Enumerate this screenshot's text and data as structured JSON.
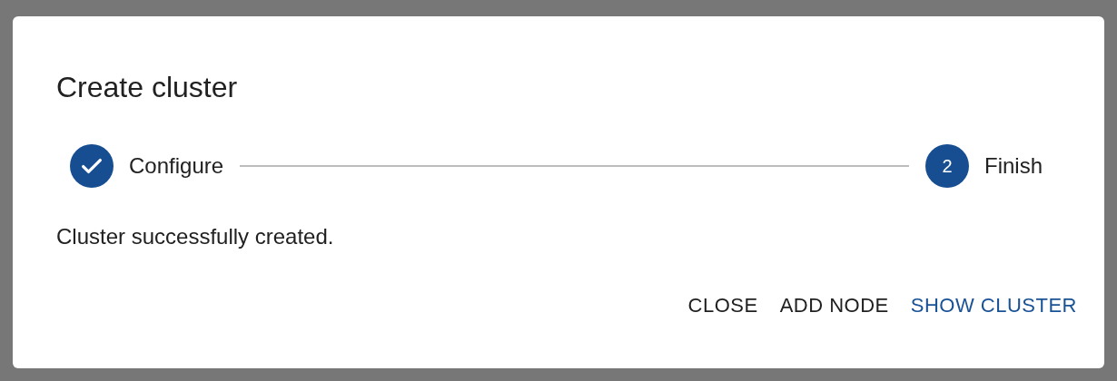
{
  "dialog": {
    "title": "Create cluster",
    "steps": [
      {
        "label": "Configure",
        "completed": true
      },
      {
        "label": "Finish",
        "completed": false,
        "number": "2"
      }
    ],
    "message": "Cluster successfully created.",
    "buttons": [
      {
        "label": "CLOSE",
        "primary": false
      },
      {
        "label": "ADD NODE",
        "primary": false
      },
      {
        "label": "SHOW CLUSTER",
        "primary": true
      }
    ]
  }
}
